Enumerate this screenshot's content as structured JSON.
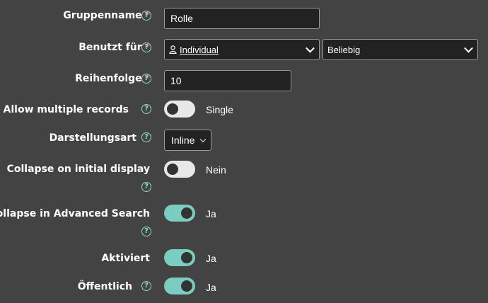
{
  "fields": {
    "gruppenname": {
      "label": "Gruppenname",
      "required": "*",
      "value": "Rolle"
    },
    "benutzt_fuer": {
      "label": "Benutzt für",
      "required": "*",
      "value1": "Individual",
      "value2": "Beliebig"
    },
    "reihenfolge": {
      "label": "Reihenfolge",
      "required": "*",
      "value": "10"
    },
    "allow_multiple": {
      "label": "Allow multiple records",
      "state_label": "Single",
      "on": false
    },
    "darstellungsart": {
      "label": "Darstellungsart",
      "value": "Inline"
    },
    "collapse_initial": {
      "label": "Collapse on initial display",
      "state_label": "Nein",
      "on": false
    },
    "collapse_advanced": {
      "label": "Collapse in Advanced Search",
      "state_label": "Ja",
      "on": true
    },
    "aktiviert": {
      "label": "Aktiviert",
      "state_label": "Ja",
      "on": true
    },
    "oeffentlich": {
      "label": "Öffentlich",
      "state_label": "Ja",
      "on": true
    }
  },
  "help_glyph": "?",
  "colors": {
    "background": "#434343",
    "required": "#e0636e",
    "accent": "#7ccdc1",
    "help": "#8fd9cc"
  }
}
